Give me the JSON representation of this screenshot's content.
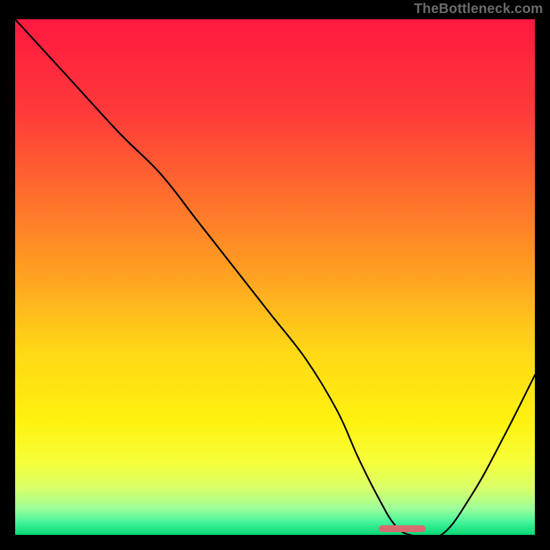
{
  "watermark": "TheBottleneck.com",
  "chart_data": {
    "type": "line",
    "title": "",
    "xlabel": "",
    "ylabel": "",
    "xlim": [
      0,
      100
    ],
    "ylim": [
      0,
      100
    ],
    "grid": false,
    "legend": false,
    "series": [
      {
        "name": "curve",
        "x": [
          0,
          10,
          20,
          28,
          35,
          42,
          49,
          56,
          62,
          66,
          70,
          73,
          76,
          82,
          88,
          94,
          100
        ],
        "y": [
          100,
          89,
          78,
          70,
          61,
          52,
          43,
          34,
          24,
          15,
          7,
          2,
          0,
          0,
          8,
          19,
          31
        ]
      }
    ],
    "marker": {
      "x_range": [
        70,
        79
      ],
      "y": 0,
      "color": "#d86b6f"
    },
    "background_gradient": {
      "stops": [
        {
          "pos": 0.0,
          "color": "#ff193f"
        },
        {
          "pos": 0.18,
          "color": "#ff3a3a"
        },
        {
          "pos": 0.34,
          "color": "#ff6d2d"
        },
        {
          "pos": 0.5,
          "color": "#ffa321"
        },
        {
          "pos": 0.64,
          "color": "#ffd716"
        },
        {
          "pos": 0.78,
          "color": "#fff20f"
        },
        {
          "pos": 0.86,
          "color": "#f6ff3a"
        },
        {
          "pos": 0.91,
          "color": "#d8ff6a"
        },
        {
          "pos": 0.95,
          "color": "#9bff9b"
        },
        {
          "pos": 0.975,
          "color": "#45f59b"
        },
        {
          "pos": 1.0,
          "color": "#07d675"
        }
      ]
    }
  }
}
